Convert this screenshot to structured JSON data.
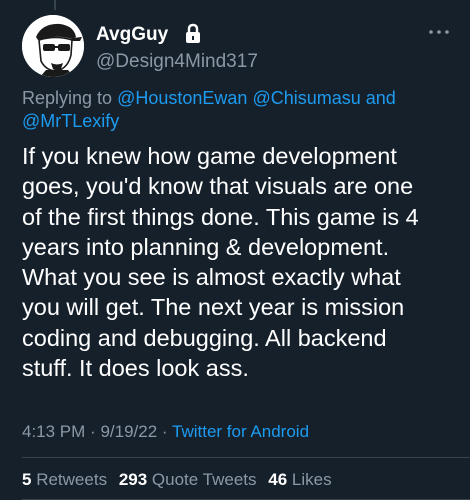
{
  "author": {
    "display_name": "AvgGuy",
    "handle": "@Design4Mind317",
    "avatar": "cartoon-man-cap-sunglasses",
    "protected_icon": "lock-icon"
  },
  "reply": {
    "prefix": "Replying to",
    "mentions": [
      "@HoustonEwan",
      "@Chisumasu",
      "@MrTLexify"
    ],
    "conjunction": "and"
  },
  "tweet": {
    "lines": [
      "If you knew how game development",
      "goes, you'd know that visuals are one",
      "of the first things done. This game is 4",
      "years into planning & development.",
      "What you see is almost exactly what",
      "you will get. The next year is mission",
      "coding and debugging. All backend",
      "stuff. It does look ass."
    ]
  },
  "meta": {
    "time": "4:13 PM",
    "separator": "·",
    "date": "9/19/22",
    "source": "Twitter for Android"
  },
  "stats": {
    "retweets": {
      "count": "5",
      "label": "Retweets"
    },
    "quotes": {
      "count": "293",
      "label": "Quote Tweets"
    },
    "likes": {
      "count": "46",
      "label": "Likes"
    }
  },
  "colors": {
    "background": "#15202b",
    "text_primary": "#ffffff",
    "text_secondary": "#8b98a5",
    "link": "#1d9bf0",
    "divider": "#38444d"
  }
}
